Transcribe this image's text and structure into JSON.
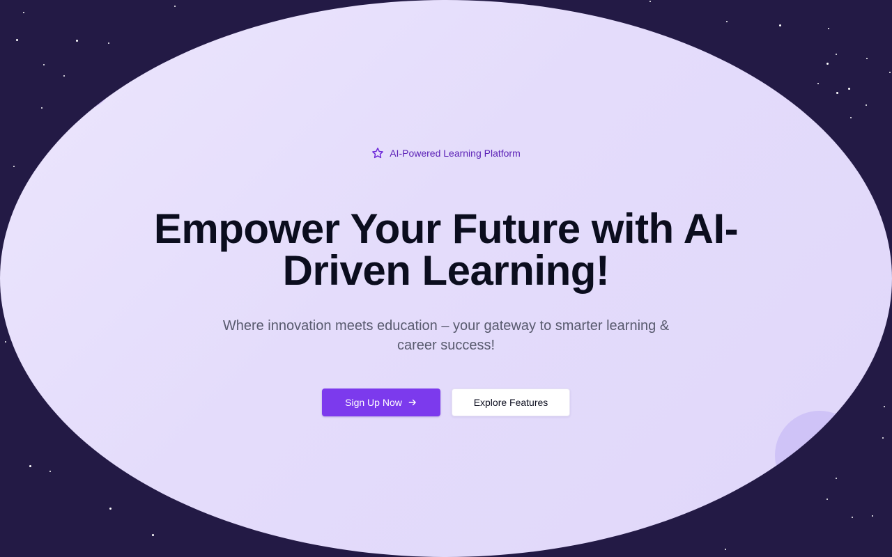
{
  "theme": {
    "background": "#231a45",
    "blob_gradient": [
      "#ece6fd",
      "#e4dcfb",
      "#e0d7fa"
    ],
    "accent": "#7c3aed",
    "badge_text_color": "#5b21b6",
    "headline_color": "#0b0d1e",
    "subtitle_color": "#585a6e"
  },
  "hero": {
    "badge": {
      "icon": "star-icon",
      "label": "AI-Powered Learning Platform"
    },
    "headline_line1": "Empower Your Future with AI-",
    "headline_line2": "Driven Learning!",
    "subtitle_line1": "Where innovation meets education – your gateway to smarter learning &",
    "subtitle_line2": "career success!",
    "primary_cta": {
      "label": "Sign Up Now",
      "icon": "arrow-right-icon"
    },
    "secondary_cta": {
      "label": "Explore Features"
    }
  }
}
